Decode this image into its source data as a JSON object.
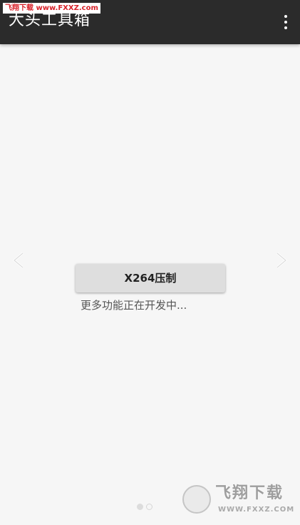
{
  "app_bar": {
    "title": "大头工具箱",
    "menu_icon": "more-vert-icon"
  },
  "watermark_top": {
    "text": "飞翔下载 www.FXXZ.com"
  },
  "pager": {
    "prev_icon": "chevron-left-icon",
    "next_icon": "chevron-right-icon",
    "dots": [
      {
        "state": "active"
      },
      {
        "state": "inactive"
      }
    ]
  },
  "main": {
    "button_label": "X264压制",
    "more_text": "更多功能正在开发中..."
  },
  "watermark_logo": {
    "brand": "飞翔下载",
    "url": "WWW.FXXZ.COM"
  },
  "colors": {
    "app_bar_bg": "#2b2b2b",
    "background": "#f6f6f6",
    "button_bg": "#dedede",
    "watermark_red": "#d8222a"
  }
}
